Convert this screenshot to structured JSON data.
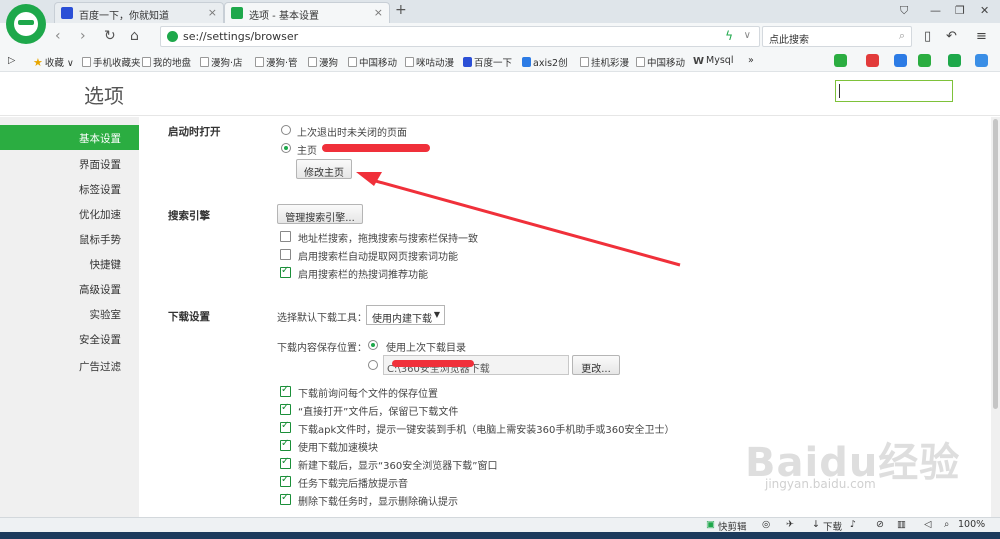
{
  "tabs": [
    {
      "label": "百度一下，你就知道",
      "active": false
    },
    {
      "label": "选项 - 基本设置",
      "active": true
    }
  ],
  "address": {
    "url": "se://settings/browser"
  },
  "search": {
    "text": "点此搜索"
  },
  "bookmarks": [
    "收藏",
    "手机收藏夹",
    "我的地盘",
    "漫狗·店",
    "漫狗·管",
    "漫狗",
    "中国移动",
    "咪咕动漫",
    "百度一下",
    "axis2创",
    "挂机彩漫",
    "中国移动",
    "Mysql"
  ],
  "page": {
    "title": "选项"
  },
  "sidebar": {
    "items": [
      "基本设置",
      "界面设置",
      "标签设置",
      "优化加速",
      "鼠标手势",
      "快捷键",
      "高级设置",
      "实验室",
      "安全设置",
      "广告过滤"
    ]
  },
  "startup": {
    "title": "启动时打开",
    "opt1": "上次退出时未关闭的页面",
    "opt2": "主页",
    "edit_home": "修改主页"
  },
  "search_engine": {
    "title": "搜索引擎",
    "manage": "管理搜索引擎...",
    "opts": [
      {
        "label": "地址栏搜索，拖拽搜索与搜索栏保持一致",
        "checked": false
      },
      {
        "label": "启用搜索栏自动提取网页搜索词功能",
        "checked": false
      },
      {
        "label": "启用搜索栏的热搜词推荐功能",
        "checked": true
      }
    ]
  },
  "download": {
    "title": "下载设置",
    "tool_label": "选择默认下载工具：",
    "tool_value": "使用内建下载",
    "save_label": "下载内容保存位置：",
    "save_opt1": "使用上次下载目录",
    "save_path": "C:\\360安全浏览器下载",
    "change": "更改...",
    "opts": [
      {
        "label": "下载前询问每个文件的保存位置",
        "checked": true
      },
      {
        "label": "“直接打开”文件后，保留已下载文件",
        "checked": true
      },
      {
        "label": "下载apk文件时，提示一键安装到手机（电脑上需安装360手机助手或360安全卫士）",
        "checked": true
      },
      {
        "label": "使用下载加速模块",
        "checked": true
      },
      {
        "label": "新建下载后，显示“360安全浏览器下载”窗口",
        "checked": true
      },
      {
        "label": "任务下载完后播放提示音",
        "checked": true
      },
      {
        "label": "删除下载任务时，显示删除确认提示",
        "checked": true
      }
    ]
  },
  "statusbar": {
    "quick": "快剪辑",
    "download": "下载",
    "zoom": "100%"
  },
  "watermark": {
    "main": "Baidu经验",
    "sub": "jingyan.baidu.com"
  },
  "colors": {
    "accent": "#2bad41",
    "redact": "#f0303a"
  }
}
